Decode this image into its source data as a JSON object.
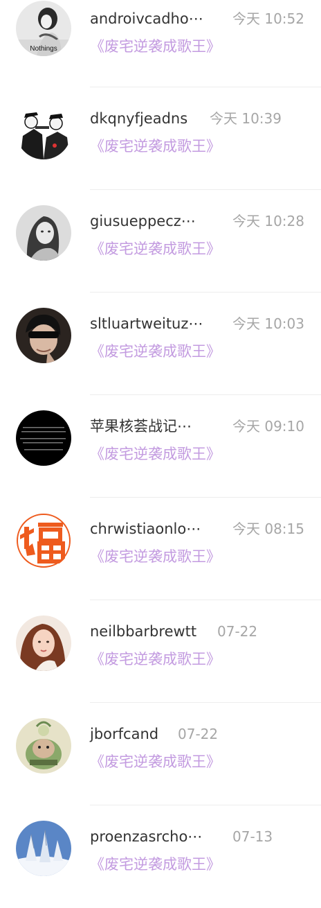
{
  "messages": [
    {
      "username": "androivcadho⋯",
      "time": "今天 10:52",
      "book": "《废宅逆袭成歌王》",
      "avatar_text": "Nothings"
    },
    {
      "username": "dkqnyfjeadns",
      "time": "今天 10:39",
      "book": "《废宅逆袭成歌王》"
    },
    {
      "username": "giusueppecz⋯",
      "time": "今天 10:28",
      "book": "《废宅逆袭成歌王》"
    },
    {
      "username": "sltluartweituz⋯",
      "time": "今天 10:03",
      "book": "《废宅逆袭成歌王》"
    },
    {
      "username": "苹果核荟战记⋯",
      "time": "今天 09:10",
      "book": "《废宅逆袭成歌王》"
    },
    {
      "username": "chrwistiaonlo⋯",
      "time": "今天 08:15",
      "book": "《废宅逆袭成歌王》"
    },
    {
      "username": "neilbbarbrewtt",
      "time": "07-22",
      "book": "《废宅逆袭成歌王》"
    },
    {
      "username": "jborfcand",
      "time": "07-22",
      "book": "《废宅逆袭成歌王》"
    },
    {
      "username": "proenzasrcho⋯",
      "time": "07-13",
      "book": "《废宅逆袭成歌王》"
    }
  ]
}
